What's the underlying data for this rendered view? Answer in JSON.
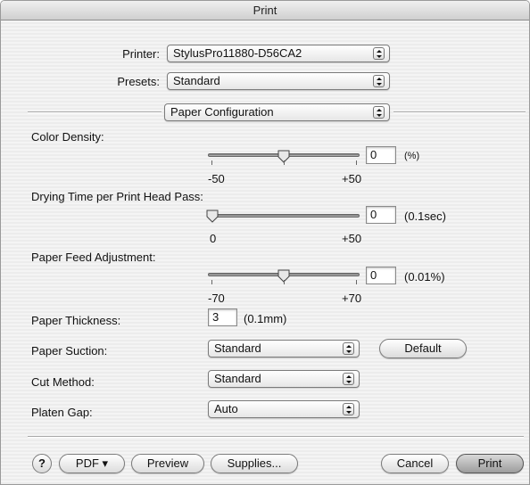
{
  "window": {
    "title": "Print"
  },
  "printer": {
    "label": "Printer:",
    "value": "StylusPro11880-D56CA2"
  },
  "presets": {
    "label": "Presets:",
    "value": "Standard"
  },
  "pane": {
    "value": "Paper Configuration"
  },
  "color_density": {
    "label": "Color Density:",
    "min_label": "-50",
    "max_label": "+50",
    "value": "0",
    "unit": "(%)",
    "level": 0.5
  },
  "drying_time": {
    "label": "Drying Time per Print Head Pass:",
    "min_label": "0",
    "max_label": "+50",
    "value": "0",
    "unit": "(0.1sec)",
    "level": 0.0
  },
  "paper_feed": {
    "label": "Paper Feed Adjustment:",
    "min_label": "-70",
    "max_label": "+70",
    "value": "0",
    "unit": "(0.01%)",
    "level": 0.5
  },
  "paper_thickness": {
    "label": "Paper Thickness:",
    "value": "3",
    "unit": "(0.1mm)"
  },
  "paper_suction": {
    "label": "Paper Suction:",
    "value": "Standard",
    "default_button": "Default"
  },
  "cut_method": {
    "label": "Cut Method:",
    "value": "Standard"
  },
  "platen_gap": {
    "label": "Platen Gap:",
    "value": "Auto"
  },
  "footer": {
    "help": "?",
    "pdf": "PDF ▾",
    "preview": "Preview",
    "supplies": "Supplies...",
    "cancel": "Cancel",
    "print": "Print"
  }
}
